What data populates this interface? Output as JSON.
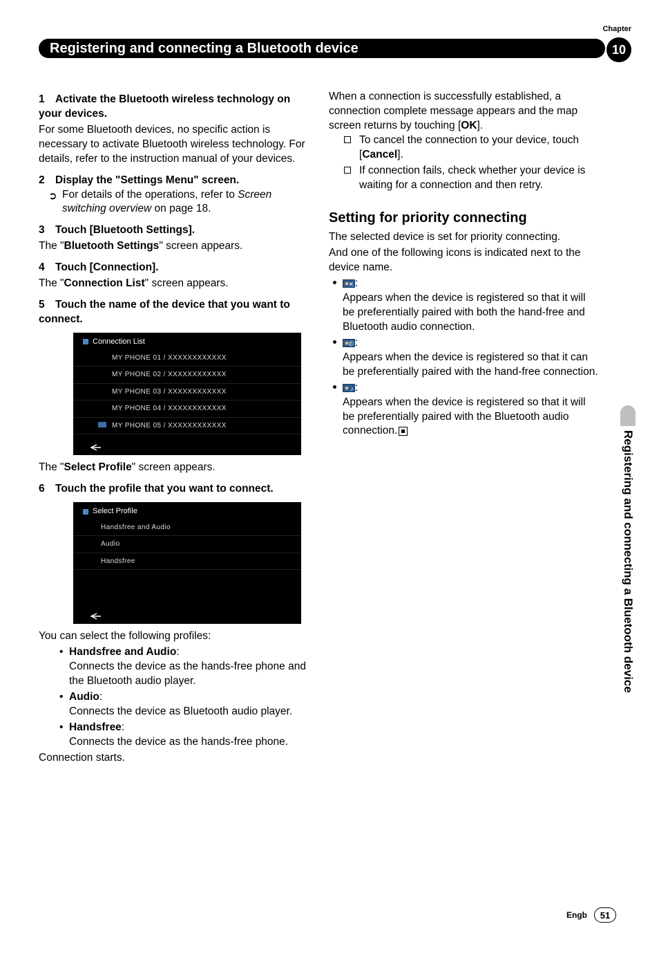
{
  "header": {
    "chapter_label": "Chapter",
    "chapter_number": "10",
    "banner_title": "Registering and connecting a Bluetooth device"
  },
  "left": {
    "s1_head": "Activate the Bluetooth wireless technology on your devices.",
    "s1_body": "For some Bluetooth devices, no specific action is necessary to activate Bluetooth wireless technology. For details, refer to the instruction manual of your devices.",
    "s2_head": "Display the \"Settings Menu\" screen.",
    "s2_ref_a": "For details of the operations, refer to ",
    "s2_ref_b": "Screen switching overview",
    "s2_ref_c": " on page 18.",
    "s3_head": "Touch [Bluetooth Settings].",
    "s3_body_a": "The \"",
    "s3_body_b": "Bluetooth Settings",
    "s3_body_c": "\" screen appears.",
    "s4_head": "Touch [Connection].",
    "s4_body_a": "The \"",
    "s4_body_b": "Connection List",
    "s4_body_c": "\" screen appears.",
    "s5_head": "Touch the name of the device that you want to connect.",
    "connection_list_title": "Connection List",
    "connection_list": [
      "MY PHONE 01 / XXXXXXXXXXXX",
      "MY PHONE 02 / XXXXXXXXXXXX",
      "MY PHONE 03 / XXXXXXXXXXXX",
      "MY PHONE 04 / XXXXXXXXXXXX",
      "MY PHONE 05 / XXXXXXXXXXXX"
    ],
    "after5_a": "The \"",
    "after5_b": "Select Profile",
    "after5_c": "\" screen appears.",
    "s6_head": "Touch the profile that you want to connect.",
    "select_profile_title": "Select Profile",
    "select_profile_items": [
      "Handsfree and Audio",
      "Audio",
      "Handsfree"
    ],
    "profiles_intro": "You can select the following profiles:",
    "p1_name": "Handsfree and Audio",
    "p1_desc": "Connects the device as the hands-free phone and the Bluetooth audio player.",
    "p2_name": "Audio",
    "p2_desc": "Connects the device as Bluetooth audio player.",
    "p3_name": "Handsfree",
    "p3_desc": "Connects the device as the hands-free phone.",
    "conn_starts": "Connection starts."
  },
  "right": {
    "r1_a": "When a connection is successfully established, a connection complete message appears and the map screen returns by touching [",
    "r1_b": "OK",
    "r1_c": "].",
    "cancel_a": "To cancel the connection to your device, touch [",
    "cancel_b": "Cancel",
    "cancel_c": "].",
    "fail": "If connection fails, check whether your device is waiting for a connection and then retry.",
    "h2": "Setting for priority connecting",
    "sp1": "The selected device is set for priority connecting.",
    "sp2": "And one of the following icons is indicated next to the device name.",
    "i1": "Appears when the device is registered so that it will be preferentially paired with both the hand-free and Bluetooth audio connection.",
    "i2": "Appears when the device is registered so that it can be preferentially paired with the hand-free connection.",
    "i3": "Appears when the device is registered so that it will be preferentially paired with the Bluetooth audio connection."
  },
  "side_tab": "Registering and connecting a Bluetooth device",
  "footer": {
    "lang": "Engb",
    "page": "51"
  }
}
